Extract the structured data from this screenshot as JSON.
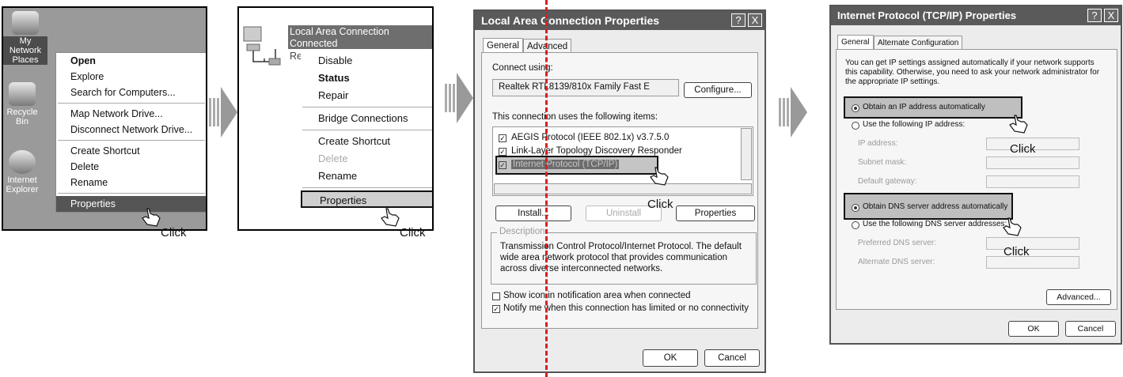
{
  "panel1": {
    "desktop_icons": [
      {
        "label": "My Network Places"
      },
      {
        "label": "Recycle Bin"
      },
      {
        "label": "Internet Explorer"
      }
    ],
    "menu": [
      {
        "label": "Open",
        "bold": true
      },
      {
        "label": "Explore"
      },
      {
        "label": "Search for Computers..."
      },
      {
        "sep": true
      },
      {
        "label": "Map Network Drive..."
      },
      {
        "label": "Disconnect Network Drive..."
      },
      {
        "sep": true
      },
      {
        "label": "Create Shortcut"
      },
      {
        "label": "Delete"
      },
      {
        "label": "Rename"
      },
      {
        "sep": true
      },
      {
        "label": "Properties",
        "highlight": true
      }
    ],
    "click": "Click"
  },
  "panel2": {
    "connection_name": "Local Area Connection",
    "connection_status": "Connected",
    "connection_extra": "Re",
    "menu": [
      {
        "label": "Disable"
      },
      {
        "label": "Status",
        "bold": true
      },
      {
        "label": "Repair"
      },
      {
        "sep": true
      },
      {
        "label": "Bridge Connections"
      },
      {
        "sep": true
      },
      {
        "label": "Create Shortcut"
      },
      {
        "label": "Delete",
        "disabled": true
      },
      {
        "label": "Rename"
      },
      {
        "sep": true
      },
      {
        "label": "Properties",
        "highlight": true
      }
    ],
    "click": "Click"
  },
  "dialog1": {
    "title": "Local Area Connection Properties",
    "help_btn": "?",
    "close_btn": "X",
    "tabs": [
      "General",
      "Advanced"
    ],
    "connect_using": "Connect using:",
    "adapter": "Realtek RTL8139/810x Family Fast E",
    "configure": "Configure...",
    "items_label": "This connection uses the following items:",
    "items": [
      "AEGIS Protocol (IEEE 802.1x) v3.7.5.0",
      "Link-Layer Topology Discovery Responder",
      "Internet Protocol (TCP/IP)"
    ],
    "install": "Install...",
    "uninstall": "Uninstall",
    "properties": "Properties",
    "description_label": "Description",
    "description": [
      "Transmission Control Protocol/Internet Protocol. The default",
      "wide area network protocol that provides communication",
      "across diverse interconnected networks."
    ],
    "show_icon": "Show icon in notification area when connected",
    "notify": "Notify me when this connection has limited or no connectivity",
    "ok": "OK",
    "cancel": "Cancel",
    "click": "Click"
  },
  "dialog2": {
    "title": "Internet Protocol (TCP/IP) Properties",
    "help_btn": "?",
    "close_btn": "X",
    "tabs": [
      "General",
      "Alternate Configuration"
    ],
    "intro": [
      "You can get IP settings assigned automatically if your network supports",
      "this capability. Otherwise, you need to ask your network administrator for",
      "the appropriate IP settings."
    ],
    "obtain_ip": "Obtain an IP address automatically",
    "use_ip": "Use the following IP address:",
    "ip_address": "IP address:",
    "subnet": "Subnet mask:",
    "gateway": "Default gateway:",
    "obtain_dns": "Obtain DNS server address automatically",
    "use_dns": "Use the following DNS server addresses:",
    "preferred_dns": "Preferred DNS server:",
    "alternate_dns": "Alternate DNS server:",
    "advanced": "Advanced...",
    "ok": "OK",
    "cancel": "Cancel",
    "click": "Click"
  }
}
